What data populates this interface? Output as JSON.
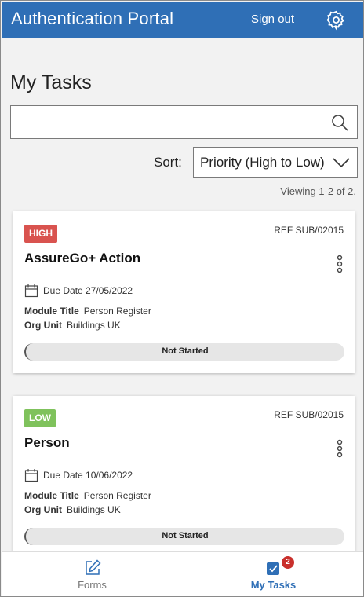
{
  "header": {
    "title": "Authentication Portal",
    "sign_out": "Sign out",
    "settings_icon": "gear-icon",
    "color": "#2f6fb6"
  },
  "page": {
    "title": "My Tasks",
    "search": {
      "value": "",
      "placeholder": "",
      "icon": "search-icon"
    },
    "sort": {
      "label": "Sort:",
      "selected": "Priority (High to Low)",
      "icon": "chevron-down-icon"
    },
    "viewing": "Viewing 1-2 of 2."
  },
  "tasks": [
    {
      "priority": "HIGH",
      "priority_color": "#d9534f",
      "ref_label": "REF",
      "ref": "SUB/02015",
      "title": "AssureGo+ Action",
      "due_label": "Due Date",
      "due_date": "27/05/2022",
      "module_label": "Module Title",
      "module_value": "Person Register",
      "org_label": "Org Unit",
      "org_value": "Buildings UK",
      "status": "Not Started",
      "progress": 0
    },
    {
      "priority": "LOW",
      "priority_color": "#7fc25c",
      "ref_label": "REF",
      "ref": "SUB/02015",
      "title": "Person",
      "due_label": "Due Date",
      "due_date": "10/06/2022",
      "module_label": "Module Title",
      "module_value": "Person Register",
      "org_label": "Org Unit",
      "org_value": "Buildings UK",
      "status": "Not Started",
      "progress": 0
    }
  ],
  "bottom_nav": {
    "forms": {
      "label": "Forms",
      "icon": "edit-icon"
    },
    "my_tasks": {
      "label": "My Tasks",
      "icon": "checkbox-icon",
      "badge": "2",
      "active": true
    }
  }
}
